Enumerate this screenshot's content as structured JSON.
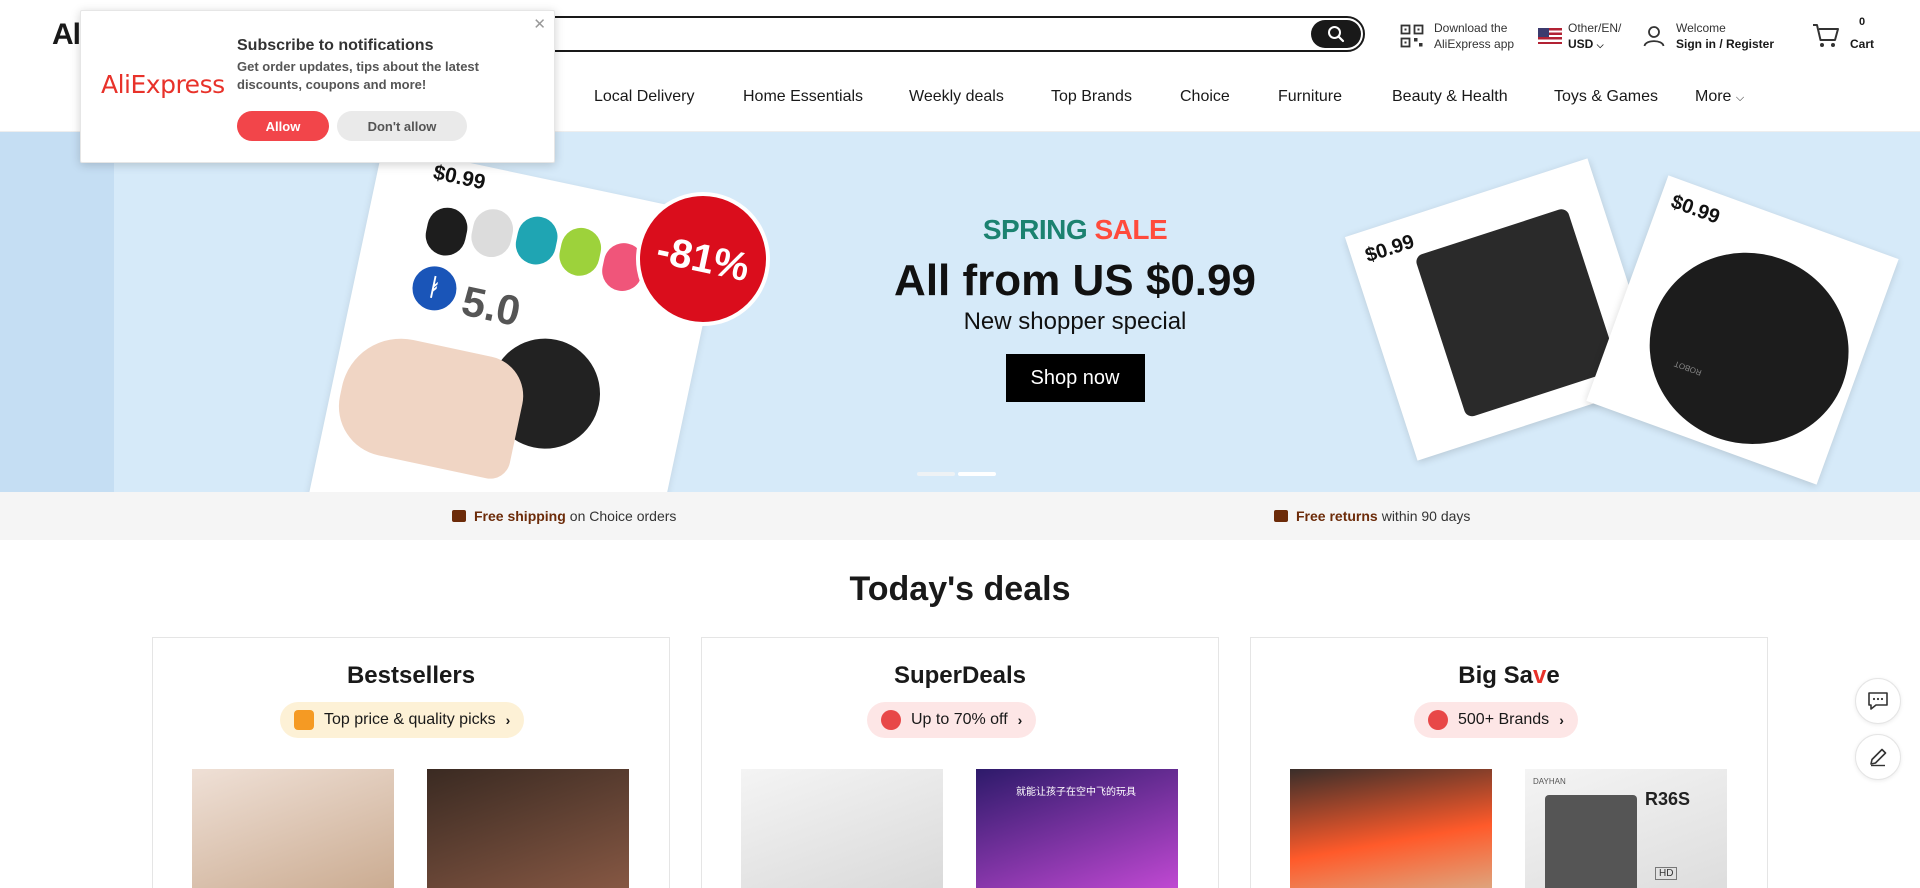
{
  "header": {
    "logo_text": "Al",
    "utils": {
      "app_line1": "Download the",
      "app_line2": "AliExpress app",
      "lang_line1": "Other/EN/",
      "lang_line2": "USD",
      "user_line1": "Welcome",
      "user_line2": "Sign in / Register",
      "cart_count": "0",
      "cart_label": "Cart"
    }
  },
  "nav": {
    "items": [
      "Local Delivery",
      "Home Essentials",
      "Weekly deals",
      "Top Brands",
      "Choice",
      "Furniture",
      "Beauty & Health",
      "Toys & Games",
      "More"
    ]
  },
  "popup": {
    "brand": "AliExpress",
    "close": "✕",
    "title": "Subscribe to notifications",
    "body": "Get order updates, tips about the latest discounts, coupons and more!",
    "allow": "Allow",
    "deny": "Don't allow"
  },
  "banner": {
    "spring_1": "SPRING",
    "spring_2": "SALE",
    "headline": "All from US $0.99",
    "subheadline": "New shopper special",
    "cta": "Shop now",
    "left_price": "$0.99",
    "discount": "-81%",
    "left_product_text": "5.0",
    "right1_price": "$0.99",
    "right2_price": "$0.99",
    "right2_product_text": "ROBOT"
  },
  "shipping": {
    "item1_bold": "Free shipping",
    "item1_rest": "on Choice orders",
    "item2_bold": "Free returns",
    "item2_rest": "within 90 days"
  },
  "deals": {
    "title": "Today's deals",
    "cards": [
      {
        "title": "Bestsellers",
        "pill": "Top price & quality picks"
      },
      {
        "title": "SuperDeals",
        "pill": "Up to 70% off"
      },
      {
        "title_1": "Big Sa",
        "title_2": "v",
        "title_3": "e",
        "pill": "500+ Brands"
      }
    ],
    "product_texts": {
      "superdeals_2": "就能让孩子在空中飞的玩具",
      "bigsave_2": "R36S",
      "bigsave_2_brand": "DAYHAN",
      "bigsave_2_badge_1": "HD"
    }
  },
  "colors": {
    "accent_red": "#f2454a",
    "spring_green": "#1b8270",
    "sale_red": "#ff4b3c",
    "brown": "#6c2b09",
    "banner_bg": "#d6eaf9"
  },
  "icons": [
    "search-icon",
    "qr-code-icon",
    "us-flag-icon",
    "chevron-down-icon",
    "user-icon",
    "cart-icon",
    "truck-icon",
    "return-box-icon",
    "chat-icon",
    "edit-icon",
    "chevron-right-icon"
  ]
}
